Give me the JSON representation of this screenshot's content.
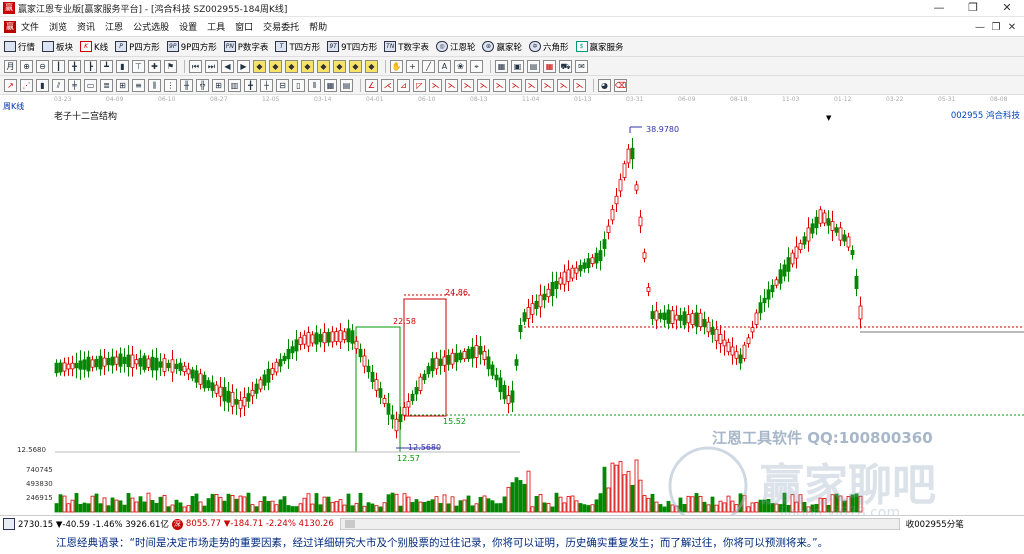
{
  "window": {
    "title": "赢家江恩专业版[赢家服务平台] - [鸿合科技  SZ002955-184周K线]",
    "controls": [
      "—",
      "❐",
      "✕"
    ]
  },
  "menu": {
    "items": [
      "文件",
      "浏览",
      "资讯",
      "江恩",
      "公式选股",
      "设置",
      "工具",
      "窗口",
      "交易委托",
      "帮助"
    ],
    "mdi_controls": [
      "—",
      "❐",
      "✕"
    ]
  },
  "toolbar1": {
    "items": [
      {
        "icon": "grid-icon",
        "label": "行情"
      },
      {
        "icon": "blocks-icon",
        "label": "板块"
      },
      {
        "icon": "kline-icon",
        "label": "K线"
      },
      {
        "icon": "p-square-icon",
        "label": "P四方形"
      },
      {
        "icon": "9p-square-icon",
        "label": "9P四方形"
      },
      {
        "icon": "pn-icon",
        "label": "P数字表"
      },
      {
        "icon": "t-square-icon",
        "label": "T四方形"
      },
      {
        "icon": "9t-square-icon",
        "label": "9T四方形"
      },
      {
        "icon": "tn-icon",
        "label": "T数字表"
      },
      {
        "icon": "gann-wheel-icon",
        "label": "江恩轮"
      },
      {
        "icon": "winner-wheel-icon",
        "label": "赢家轮"
      },
      {
        "icon": "hexagon-icon",
        "label": "六角形"
      },
      {
        "icon": "dollar-icon",
        "label": "赢家服务"
      }
    ]
  },
  "chart_header": {
    "period": "周K线",
    "indicator": "老子十二宫结构",
    "code_name": "002955  鸿合科技"
  },
  "date_strip": [
    "03-23",
    "04-09",
    "06-10",
    "08-27",
    "12-05",
    "03-14",
    "04-01",
    "06-10",
    "08-13",
    "11-04",
    "01-13",
    "03-31",
    "06-09",
    "08-18",
    "11-03",
    "01-12",
    "03-22",
    "05-31",
    "08-08"
  ],
  "chart_data": {
    "type": "candlestick",
    "annotations": {
      "high": "38.9780",
      "low_a": "12.5680",
      "low_b": "12.57",
      "box_top": "24.86",
      "box_mid": "22.58",
      "box_bottom": "15.52"
    },
    "volume_axis": [
      "740745",
      "493830",
      "246915"
    ],
    "price_axis_label": "12.5680"
  },
  "watermarks": {
    "tool": "江恩工具软件  QQ:100800360",
    "brand": "赢家聊吧",
    "site": "jiaoba.yj678.com"
  },
  "statusbar": {
    "sh_label": "沪",
    "sh_values": "2730.15 ▼-40.59 -1.46% 3926.61亿",
    "sz_label": "深",
    "sz_values": "8055.77 ▼-184.71 -2.24% 4130.26",
    "right_text": "收002955分笔"
  },
  "quote": "江恩经典语录：“时间是决定市场走势的重要因素，经过详细研究大市及个别股票的过往记录，你将可以证明，历史确实重复发生；而了解过往，你将可以预测将来。”。"
}
